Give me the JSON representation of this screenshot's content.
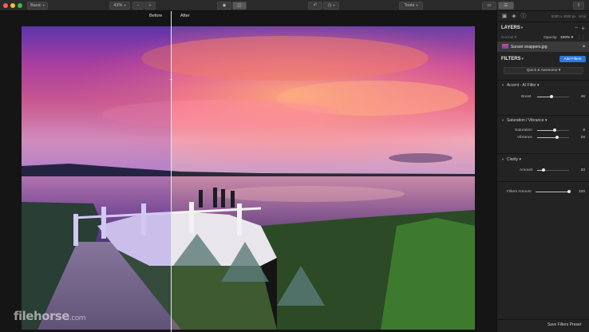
{
  "toolbar": {
    "mode_select": "Basic",
    "zoom_select": "43%",
    "zoom_out": "−",
    "zoom_in": "+",
    "tools_select": "Tools"
  },
  "compare": {
    "before_label": "Before",
    "after_label": "After"
  },
  "watermark": {
    "brand": "filehorse",
    "suffix": ".com"
  },
  "panel": {
    "image_size": "5300 x 4000 px",
    "bit_depth": "8-bit",
    "layers_title": "LAYERS",
    "blend_mode": "Normal",
    "opacity_label": "Opacity:",
    "opacity_value": "100%",
    "layer_name": "Sunset snappers.jpg",
    "filters_title": "FILTERS",
    "add_filters": "Add Filters",
    "preset": "Quick & Awesome",
    "filters": [
      {
        "title": "Accent - AI Filter",
        "controls": [
          {
            "label": "Boost",
            "value": "46",
            "fraction": 0.46
          }
        ]
      },
      {
        "title": "Saturation / Vibrance",
        "controls": [
          {
            "label": "Saturation",
            "value": "8",
            "fraction": 0.54
          },
          {
            "label": "Vibrance",
            "value": "26",
            "fraction": 0.63
          }
        ]
      },
      {
        "title": "Clarity",
        "controls": [
          {
            "label": "Amount",
            "value": "20",
            "fraction": 0.2
          }
        ]
      }
    ],
    "filters_amount_label": "Filters Amount",
    "filters_amount_value": "100",
    "filters_amount_fraction": 1.0,
    "save_preset": "Save Filters Preset"
  },
  "colors": {
    "accent": "#2f78d8",
    "panel_bg": "#232323",
    "toolbar_bg": "#2a2a2a"
  }
}
